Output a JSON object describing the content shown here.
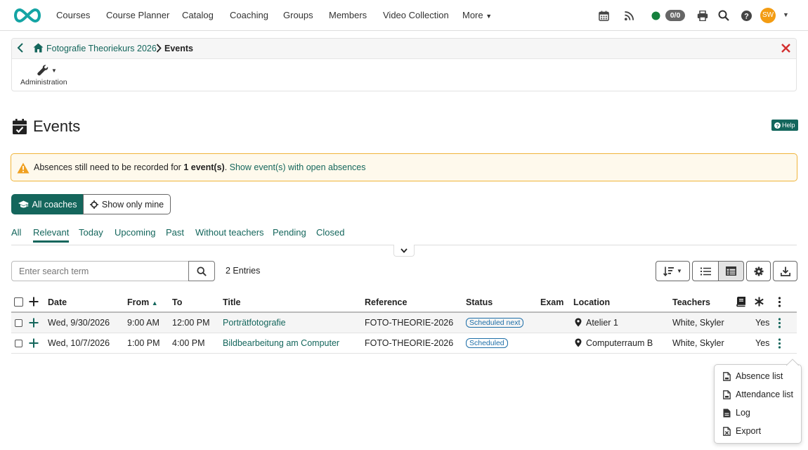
{
  "nav": {
    "items": [
      "Courses",
      "Course Planner",
      "Catalog",
      "Coaching",
      "Groups",
      "Members",
      "Video Collection",
      "More"
    ],
    "counter": "0/0",
    "avatar_initials": "SW",
    "colors": {
      "brand": "#14a4a4",
      "online": "#15803d",
      "avatar": "#f39c12"
    }
  },
  "breadcrumb": {
    "course": "Fotografie Theoriekurs 2026",
    "current": "Events"
  },
  "toolbar": {
    "administration_label": "Administration"
  },
  "page": {
    "title": "Events",
    "help_label": "Help"
  },
  "alert": {
    "text_before": "Absences still need to be recorded for ",
    "count_text": "1 event(s)",
    "text_after": ". ",
    "link_text": "Show event(s) with open absences"
  },
  "coach_filter": {
    "all_label": "All coaches",
    "mine_label": "Show only mine"
  },
  "tabs": [
    "All",
    "Relevant",
    "Today",
    "Upcoming",
    "Past",
    "Without teachers",
    "Pending",
    "Closed"
  ],
  "active_tab": "Relevant",
  "search": {
    "placeholder": "Enter search term",
    "entries": "2 Entries"
  },
  "table": {
    "headers": {
      "date": "Date",
      "from": "From",
      "to": "To",
      "title": "Title",
      "reference": "Reference",
      "status": "Status",
      "exam": "Exam",
      "location": "Location",
      "teachers": "Teachers"
    },
    "rows": [
      {
        "date": "Wed, 9/30/2026",
        "from": "9:00 AM",
        "to": "12:00 PM",
        "title": "Porträtfotografie",
        "reference": "FOTO-THEORIE-2026",
        "status": "Scheduled next",
        "location": "Atelier 1",
        "teachers": "White, Skyler",
        "yes": "Yes"
      },
      {
        "date": "Wed, 10/7/2026",
        "from": "1:00 PM",
        "to": "4:00 PM",
        "title": "Bildbearbeitung am Computer",
        "reference": "FOTO-THEORIE-2026",
        "status": "Scheduled",
        "location": "Computerraum B",
        "teachers": "White, Skyler",
        "yes": "Yes"
      }
    ]
  },
  "context_menu": {
    "items": [
      "Absence list",
      "Attendance list",
      "Log",
      "Export"
    ]
  }
}
